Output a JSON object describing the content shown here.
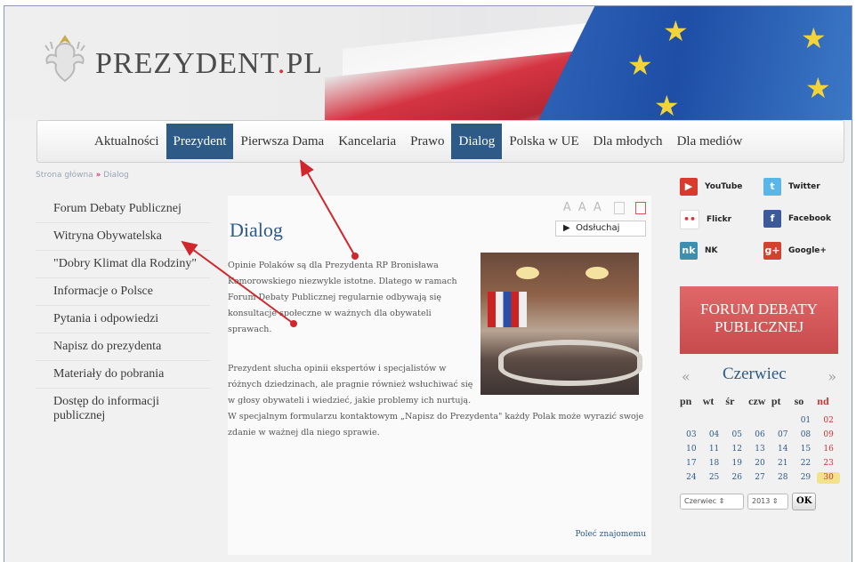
{
  "logo": {
    "text_main": "PREZYDENT",
    "text_dot": ".",
    "text_tld": "PL"
  },
  "nav": [
    "Aktualności",
    "Prezydent",
    "Pierwsza Dama",
    "Kancelaria",
    "Prawo",
    "Dialog",
    "Polska w UE",
    "Dla młodych",
    "Dla mediów"
  ],
  "breadcrumb": {
    "home": "Strona główna",
    "sep": "»",
    "current": "Dialog"
  },
  "leftnav": [
    "Forum Debaty Publicznej",
    "Witryna Obywatelska",
    "\"Dobry Klimat dla Rodziny\"",
    "Informacje o Polsce",
    "Pytania i odpowiedzi",
    "Napisz do prezydenta",
    "Materiały do pobrania",
    "Dostęp do informacji publicznej"
  ],
  "content": {
    "tools_label": "A A A",
    "listen_label": "Odsłuchaj",
    "title": "Dialog",
    "p1": "Opinie Polaków są dla Prezydenta RP Bronisława Komorowskiego niezwykle istotne. Dlatego w ramach Forum Debaty Publicznej regularnie odbywają się konsultacje społeczne w ważnych dla obywateli sprawach.",
    "p2": "Prezydent słucha opinii ekspertów i specjalistów w różnych dziedzinach, ale pragnie również wsłuchiwać się w głosy obywateli i wiedzieć, jakie problemy ich nurtują.",
    "p3": "W specjalnym formularzu kontaktowym „Napisz do Prezydenta\" każdy Polak może wyrazić swoje zdanie w ważnej dla niego sprawie.",
    "recommend": "Poleć znajomemu"
  },
  "social": [
    {
      "label": "YouTube",
      "icon": "youtube-icon",
      "color": "#d93a2b",
      "glyph": "▶"
    },
    {
      "label": "Twitter",
      "icon": "twitter-icon",
      "color": "#59b6e6",
      "glyph": "t"
    },
    {
      "label": "Flickr",
      "icon": "flickr-icon",
      "color": "#3b6fb6",
      "glyph": "••"
    },
    {
      "label": "Facebook",
      "icon": "facebook-icon",
      "color": "#3b5a9a",
      "glyph": "f"
    },
    {
      "label": "NK",
      "icon": "nk-icon",
      "color": "#3d8fb0",
      "glyph": "nk"
    },
    {
      "label": "Google+",
      "icon": "googleplus-icon",
      "color": "#d1422f",
      "glyph": "g+"
    }
  ],
  "forum_banner": {
    "line1": "FORUM DEBATY",
    "line2": "PUBLICZNEJ"
  },
  "calendar": {
    "prev": "«",
    "next": "»",
    "month": "Czerwiec",
    "weekdays": [
      "pn",
      "wt",
      "śr",
      "czw",
      "pt",
      "so",
      "nd"
    ],
    "weeks": [
      [
        "",
        "",
        "",
        "",
        "",
        "01",
        "02"
      ],
      [
        "03",
        "04",
        "05",
        "06",
        "07",
        "08",
        "09"
      ],
      [
        "10",
        "11",
        "12",
        "13",
        "14",
        "15",
        "16"
      ],
      [
        "17",
        "18",
        "19",
        "20",
        "21",
        "22",
        "23"
      ],
      [
        "24",
        "25",
        "26",
        "27",
        "28",
        "29",
        "30"
      ]
    ],
    "today": "30",
    "month_select": "Czerwiec",
    "year_select": "2013",
    "ok_label": "OK"
  },
  "colors": {
    "nav_active": "#2d5a86",
    "accent_red": "#c33",
    "forum_bg": "#d65557"
  }
}
